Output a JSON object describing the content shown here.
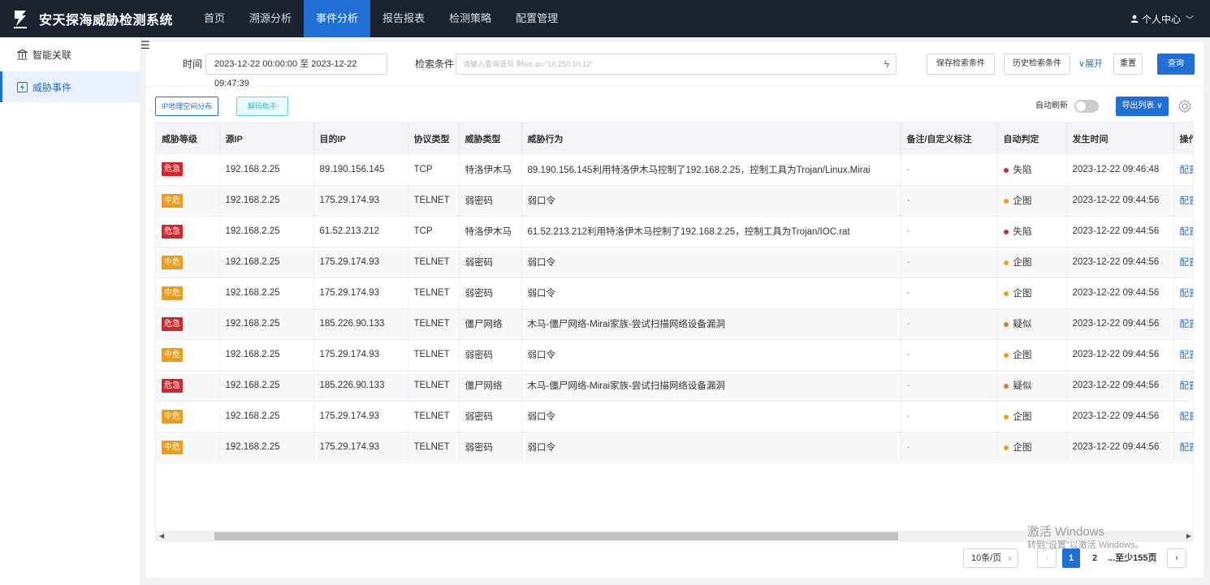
{
  "app": {
    "title": "安天探海威胁检测系统"
  },
  "nav": {
    "items": [
      {
        "label": "首页",
        "active": false
      },
      {
        "label": "溯源分析",
        "active": false
      },
      {
        "label": "事件分析",
        "active": true
      },
      {
        "label": "报告报表",
        "active": false
      },
      {
        "label": "检测策略",
        "active": false
      },
      {
        "label": "配置管理",
        "active": false
      }
    ],
    "user_label": "个人中心"
  },
  "sidebar": {
    "items": [
      {
        "label": "智能关联",
        "icon": "bank-icon",
        "active": false
      },
      {
        "label": "威胁事件",
        "icon": "alert-box-icon",
        "active": true
      }
    ]
  },
  "filter": {
    "time_label": "时间",
    "time_range": "2023-12-22 00:00:00 至 2023-12-22 09:47:39",
    "search_label": "检索条件",
    "search_placeholder": "请输入查询语句 例src.ip=\"10.250.10.12\"",
    "save_label": "保存检索条件",
    "history_label": "历史检索条件",
    "expand_label": "展开",
    "reset_label": "重置",
    "query_label": "查询"
  },
  "toolbar": {
    "ip_geo_label": "IP地理空间分布",
    "decode_label": "解码助手",
    "auto_refresh_label": "自动刷新",
    "auto_refresh_on": false,
    "export_label": "导出列表"
  },
  "table": {
    "columns": [
      "威胁等级",
      "源IP",
      "目的IP",
      "协议类型",
      "威胁类型",
      "威胁行为",
      "备注/自定义标注",
      "自动判定",
      "发生时间",
      "操作"
    ],
    "rows": [
      {
        "level": "危急",
        "level_type": "crit",
        "src": "192.168.2.25",
        "dst": "89.190.156.145",
        "proto": "TCP",
        "type": "特洛伊木马",
        "behavior": "89.190.156.145利用特洛伊木马控制了192.168.2.25，控制工具为Trojan/Linux.Mirai",
        "note": "-",
        "verdict": "失陷",
        "verdict_color": "#c9302c",
        "time": "2023-12-22 09:46:48",
        "op": "配置"
      },
      {
        "level": "中危",
        "level_type": "mid",
        "src": "192.168.2.25",
        "dst": "175.29.174.93",
        "proto": "TELNET",
        "type": "弱密码",
        "behavior": "弱口令",
        "note": "-",
        "verdict": "企图",
        "verdict_color": "#eea21c",
        "time": "2023-12-22 09:44:56",
        "op": "配置"
      },
      {
        "level": "危急",
        "level_type": "crit",
        "src": "192.168.2.25",
        "dst": "61.52.213.212",
        "proto": "TCP",
        "type": "特洛伊木马",
        "behavior": "61.52.213.212利用特洛伊木马控制了192.168.2.25，控制工具为Trojan/IOC.rat",
        "note": "-",
        "verdict": "失陷",
        "verdict_color": "#c9302c",
        "time": "2023-12-22 09:44:56",
        "op": "配置"
      },
      {
        "level": "中危",
        "level_type": "mid",
        "src": "192.168.2.25",
        "dst": "175.29.174.93",
        "proto": "TELNET",
        "type": "弱密码",
        "behavior": "弱口令",
        "note": "-",
        "verdict": "企图",
        "verdict_color": "#eea21c",
        "time": "2023-12-22 09:44:56",
        "op": "配置"
      },
      {
        "level": "中危",
        "level_type": "mid",
        "src": "192.168.2.25",
        "dst": "175.29.174.93",
        "proto": "TELNET",
        "type": "弱密码",
        "behavior": "弱口令",
        "note": "-",
        "verdict": "企图",
        "verdict_color": "#eea21c",
        "time": "2023-12-22 09:44:56",
        "op": "配置"
      },
      {
        "level": "危急",
        "level_type": "crit",
        "src": "192.168.2.25",
        "dst": "185.226.90.133",
        "proto": "TELNET",
        "type": "僵尸网络",
        "behavior": "木马-僵尸网络-Mirai家族-尝试扫描网络设备漏洞",
        "note": "-",
        "verdict": "疑似",
        "verdict_color": "#e8772a",
        "time": "2023-12-22 09:44:56",
        "op": "配置"
      },
      {
        "level": "中危",
        "level_type": "mid",
        "src": "192.168.2.25",
        "dst": "175.29.174.93",
        "proto": "TELNET",
        "type": "弱密码",
        "behavior": "弱口令",
        "note": "-",
        "verdict": "企图",
        "verdict_color": "#eea21c",
        "time": "2023-12-22 09:44:56",
        "op": "配置"
      },
      {
        "level": "危急",
        "level_type": "crit",
        "src": "192.168.2.25",
        "dst": "185.226.90.133",
        "proto": "TELNET",
        "type": "僵尸网络",
        "behavior": "木马-僵尸网络-Mirai家族-尝试扫描网络设备漏洞",
        "note": "-",
        "verdict": "疑似",
        "verdict_color": "#e8772a",
        "time": "2023-12-22 09:44:56",
        "op": "配置"
      },
      {
        "level": "中危",
        "level_type": "mid",
        "src": "192.168.2.25",
        "dst": "175.29.174.93",
        "proto": "TELNET",
        "type": "弱密码",
        "behavior": "弱口令",
        "note": "-",
        "verdict": "企图",
        "verdict_color": "#eea21c",
        "time": "2023-12-22 09:44:56",
        "op": "配置"
      },
      {
        "level": "中危",
        "level_type": "mid",
        "src": "192.168.2.25",
        "dst": "175.29.174.93",
        "proto": "TELNET",
        "type": "弱密码",
        "behavior": "弱口令",
        "note": "-",
        "verdict": "企图",
        "verdict_color": "#eea21c",
        "time": "2023-12-22 09:44:56",
        "op": "配置"
      }
    ]
  },
  "pagination": {
    "page_size": "10条/页",
    "pages": [
      "1",
      "2"
    ],
    "current": "1",
    "more": "...至少155页"
  },
  "watermark": {
    "line1": "激活 Windows",
    "line2": "转到\"设置\"以激活 Windows。"
  },
  "colors": {
    "topbar": "#1b2230",
    "accent": "#1f6fd6",
    "critical": "#d7262b",
    "medium": "#ee9b18"
  }
}
